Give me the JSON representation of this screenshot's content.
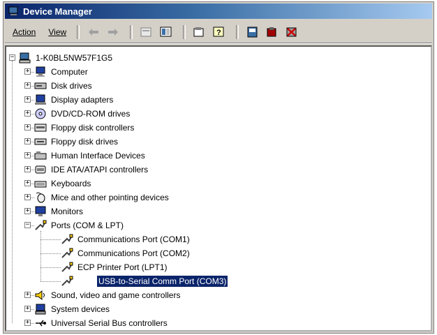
{
  "window": {
    "title": "Device Manager"
  },
  "menu": {
    "action": "Action",
    "view": "View"
  },
  "toolbar_icons": [
    "back-arrow-icon",
    "forward-arrow-icon",
    "properties-icon",
    "view-icon",
    "scan-icon",
    "help-icon",
    "update-driver-icon",
    "uninstall-icon",
    "disable-icon"
  ],
  "tree": {
    "root": "1-K0BL5NW57F1G5",
    "categories": [
      {
        "label": "Computer",
        "icon": "computer-icon"
      },
      {
        "label": "Disk drives",
        "icon": "disk-drive-icon"
      },
      {
        "label": "Display adapters",
        "icon": "display-adapter-icon"
      },
      {
        "label": "DVD/CD-ROM drives",
        "icon": "cdrom-icon"
      },
      {
        "label": "Floppy disk controllers",
        "icon": "floppy-controller-icon"
      },
      {
        "label": "Floppy disk drives",
        "icon": "floppy-drive-icon"
      },
      {
        "label": "Human Interface Devices",
        "icon": "hid-icon"
      },
      {
        "label": "IDE ATA/ATAPI controllers",
        "icon": "ide-controller-icon"
      },
      {
        "label": "Keyboards",
        "icon": "keyboard-icon"
      },
      {
        "label": "Mice and other pointing devices",
        "icon": "mouse-icon"
      },
      {
        "label": "Monitors",
        "icon": "monitor-icon"
      },
      {
        "label": "Ports (COM & LPT)",
        "icon": "port-icon"
      }
    ],
    "ports": [
      {
        "label": "Communications Port (COM1)"
      },
      {
        "label": "Communications Port (COM2)"
      },
      {
        "label": "ECP Printer Port (LPT1)"
      },
      {
        "label": "USB-to-Serial Comm Port (COM3)"
      }
    ],
    "after": [
      {
        "label": "Sound, video and game controllers",
        "icon": "sound-icon"
      },
      {
        "label": "System devices",
        "icon": "system-devices-icon"
      },
      {
        "label": "Universal Serial Bus controllers",
        "icon": "usb-icon"
      }
    ]
  },
  "colors": {
    "selection": "#0a246a",
    "titlebar": "#0a246a",
    "chrome": "#d4d0c8"
  }
}
